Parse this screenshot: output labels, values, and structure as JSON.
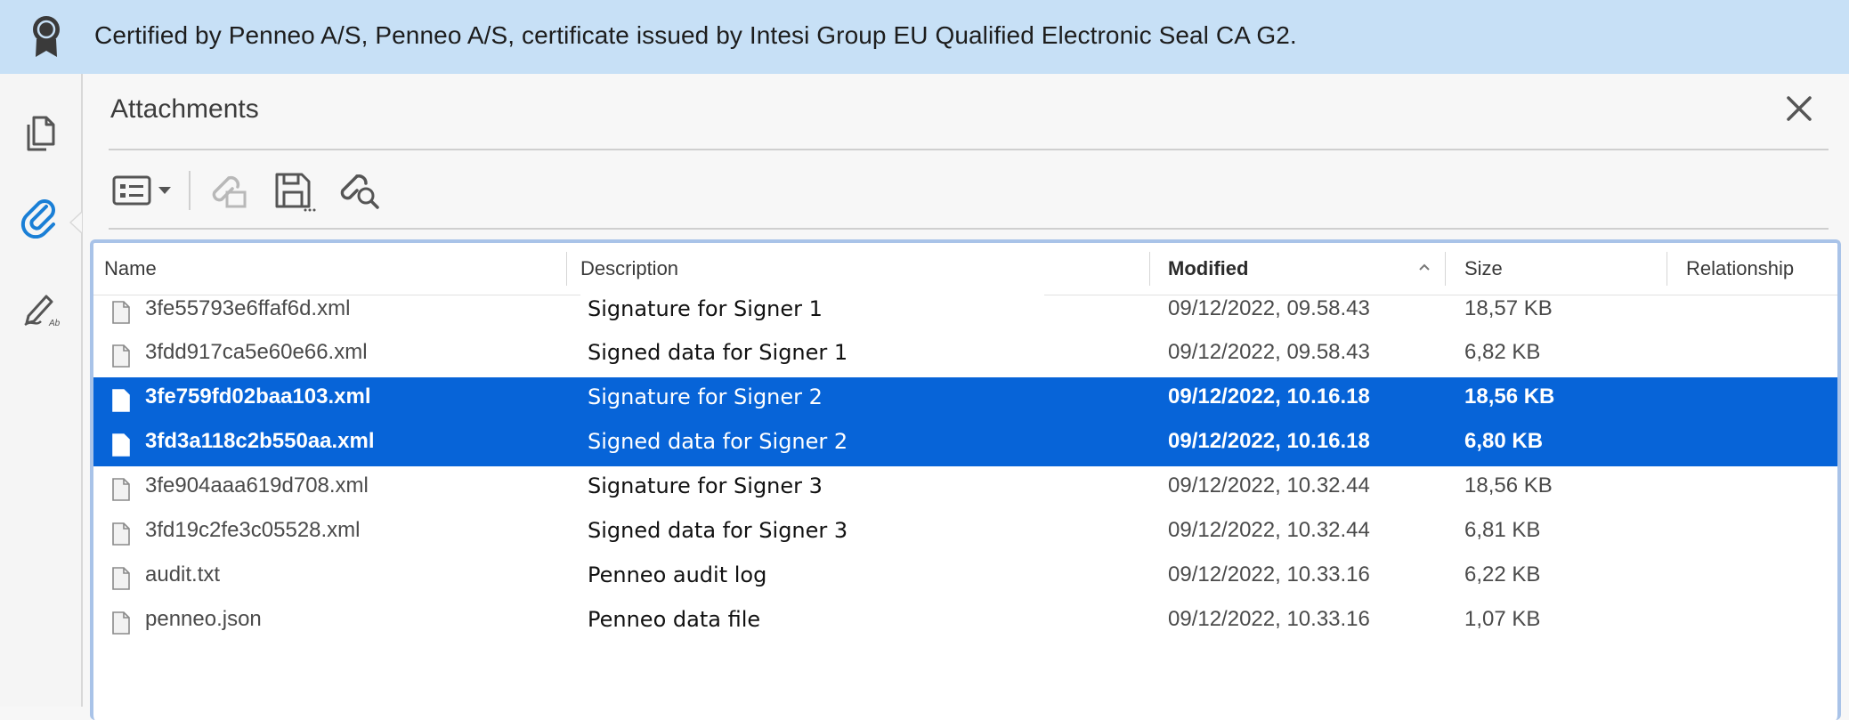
{
  "banner": {
    "text": "Certified by Penneo A/S, Penneo A/S, certificate issued by Intesi Group EU Qualified Electronic Seal CA G2.",
    "icon": "seal-ribbon-icon"
  },
  "rail": {
    "items": [
      {
        "name": "pages",
        "icon": "pages-icon"
      },
      {
        "name": "attachments",
        "icon": "paperclip-icon",
        "active": true
      },
      {
        "name": "signatures",
        "icon": "signature-pen-icon"
      }
    ]
  },
  "panel": {
    "title": "Attachments"
  },
  "toolbar": {
    "buttons": [
      "options-menu-icon",
      "add-attachment-icon",
      "save-attachment-icon",
      "search-attachment-icon"
    ]
  },
  "table": {
    "columns": [
      "Name",
      "Description",
      "Modified",
      "Size",
      "Relationship"
    ],
    "sorted_column": "Modified",
    "rows": [
      {
        "name": "3fe55793e6ffaf6d.xml",
        "description": "Signature for Signer 1",
        "modified": "09/12/2022, 09.58.43",
        "size": "18,57 KB",
        "selected": false
      },
      {
        "name": "3fdd917ca5e60e66.xml",
        "description": "Signed data for Signer 1",
        "modified": "09/12/2022, 09.58.43",
        "size": "6,82 KB",
        "selected": false
      },
      {
        "name": "3fe759fd02baa103.xml",
        "description": "Signature for Signer 2",
        "modified": "09/12/2022, 10.16.18",
        "size": "18,56 KB",
        "selected": true
      },
      {
        "name": "3fd3a118c2b550aa.xml",
        "description": "Signed data for Signer 2",
        "modified": "09/12/2022, 10.16.18",
        "size": "6,80 KB",
        "selected": true
      },
      {
        "name": "3fe904aaa619d708.xml",
        "description": "Signature for Signer 3",
        "modified": "09/12/2022, 10.32.44",
        "size": "18,56 KB",
        "selected": false
      },
      {
        "name": "3fd19c2fe3c05528.xml",
        "description": "Signed data for Signer 3",
        "modified": "09/12/2022, 10.32.44",
        "size": "6,81 KB",
        "selected": false
      },
      {
        "name": "audit.txt",
        "description": "Penneo audit log",
        "modified": "09/12/2022, 10.33.16",
        "size": "6,22 KB",
        "selected": false
      },
      {
        "name": "penneo.json",
        "description": "Penneo data file",
        "modified": "09/12/2022, 10.33.16",
        "size": "1,07 KB",
        "selected": false
      }
    ]
  },
  "colors": {
    "banner_bg": "#c7e0f6",
    "selection": "#0764d8",
    "accent": "#1a7fd6"
  }
}
